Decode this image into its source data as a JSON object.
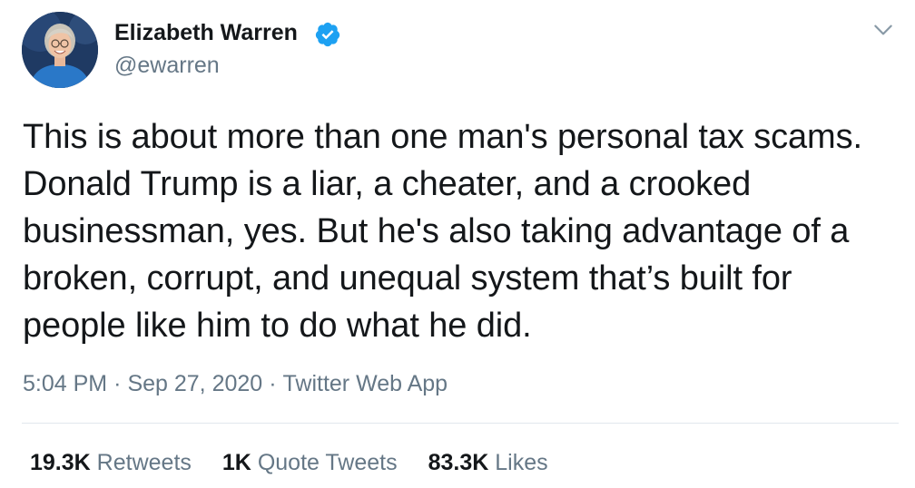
{
  "author": {
    "display_name": "Elizabeth Warren",
    "handle": "@ewarren",
    "verified": true,
    "verified_color": "#1da1f2"
  },
  "tweet": {
    "text": "This is about more than one man's personal tax scams.\nDonald Trump is a liar, a cheater, and a crooked\nbusinessman, yes. But he's also taking advantage of a\nbroken, corrupt, and unequal system that’s built for\npeople like him to do what he did.",
    "time": "5:04 PM",
    "date": "Sep 27, 2020",
    "source": "Twitter Web App",
    "separator": "·"
  },
  "stats": {
    "retweets_count": "19.3K",
    "retweets_label": "Retweets",
    "quotes_count": "1K",
    "quotes_label": "Quote Tweets",
    "likes_count": "83.3K",
    "likes_label": "Likes"
  },
  "icons": {
    "verified": "verified-badge-icon",
    "caret": "chevron-down-icon"
  },
  "colors": {
    "text": "#14171a",
    "secondary": "#657786",
    "divider": "#e1e8ed",
    "brand": "#1da1f2"
  }
}
